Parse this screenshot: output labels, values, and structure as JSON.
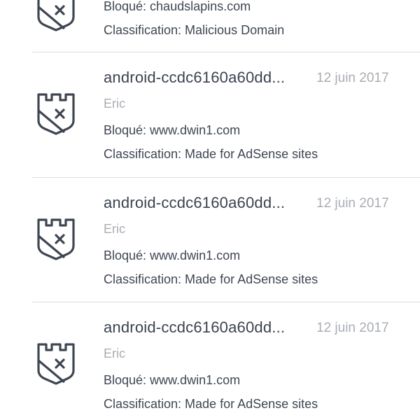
{
  "colors": {
    "primary_text": "#3b4350",
    "secondary_text": "#a9adb4",
    "icon_stroke": "#3f4652",
    "divider": "#dcdde0",
    "background": "#ffffff"
  },
  "icons": {
    "item_icon": "blocked-shield-icon"
  },
  "items": [
    {
      "blocked": "Bloqué: chaudslapins.com",
      "classification": "Classification: Malicious Domain"
    },
    {
      "device": "android-ccdc6160a60dd...",
      "date": "12 juin 2017",
      "user": "Eric",
      "blocked": "Bloqué: www.dwin1.com",
      "classification": "Classification: Made for AdSense sites"
    },
    {
      "device": "android-ccdc6160a60dd...",
      "date": "12 juin 2017",
      "user": "Eric",
      "blocked": "Bloqué: www.dwin1.com",
      "classification": "Classification: Made for AdSense sites"
    },
    {
      "device": "android-ccdc6160a60dd...",
      "date": "12 juin 2017",
      "user": "Eric",
      "blocked": "Bloqué: www.dwin1.com",
      "classification": "Classification: Made for AdSense sites"
    }
  ]
}
